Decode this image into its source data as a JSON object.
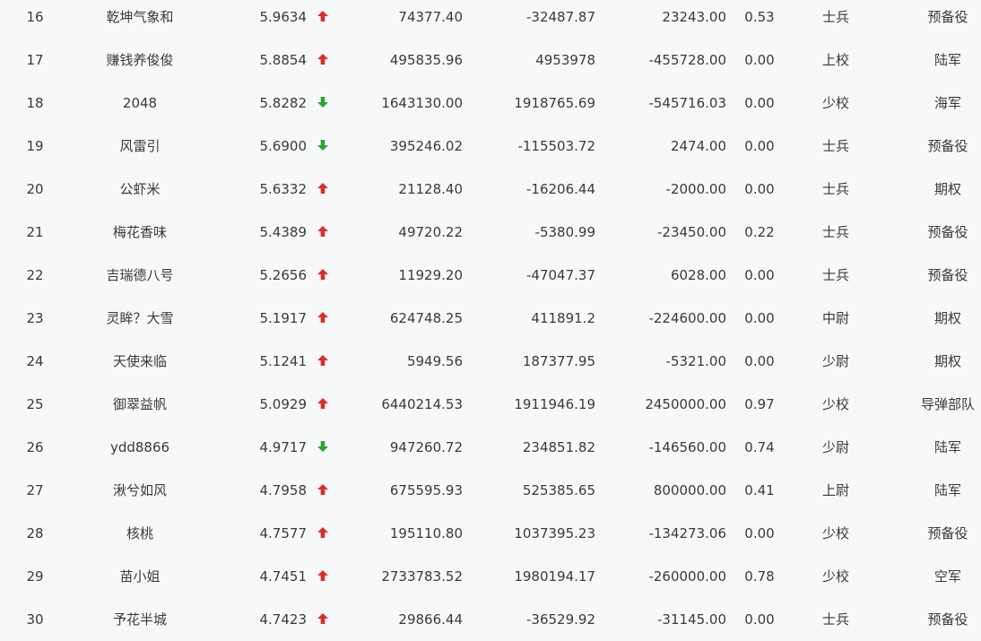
{
  "colors": {
    "up": "#e02a2a",
    "down": "#2aa52a"
  },
  "icons": {
    "up": "red-up-arrow-icon",
    "down": "green-down-arrow-icon"
  },
  "rows": [
    {
      "rank": "16",
      "name": "乾坤气象和",
      "score": "5.9634",
      "trend": "up",
      "a": "74377.40",
      "b": "-32487.87",
      "c": "23243.00",
      "d": "0.53",
      "title": "士兵",
      "branch": "预备役"
    },
    {
      "rank": "17",
      "name": "赚钱养俊俊",
      "score": "5.8854",
      "trend": "up",
      "a": "495835.96",
      "b": "4953978",
      "c": "-455728.00",
      "d": "0.00",
      "title": "上校",
      "branch": "陆军"
    },
    {
      "rank": "18",
      "name": "2048",
      "score": "5.8282",
      "trend": "down",
      "a": "1643130.00",
      "b": "1918765.69",
      "c": "-545716.03",
      "d": "0.00",
      "title": "少校",
      "branch": "海军"
    },
    {
      "rank": "19",
      "name": "风雷引",
      "score": "5.6900",
      "trend": "down",
      "a": "395246.02",
      "b": "-115503.72",
      "c": "2474.00",
      "d": "0.00",
      "title": "士兵",
      "branch": "预备役"
    },
    {
      "rank": "20",
      "name": "公虾米",
      "score": "5.6332",
      "trend": "up",
      "a": "21128.40",
      "b": "-16206.44",
      "c": "-2000.00",
      "d": "0.00",
      "title": "士兵",
      "branch": "期权"
    },
    {
      "rank": "21",
      "name": "梅花香味",
      "score": "5.4389",
      "trend": "up",
      "a": "49720.22",
      "b": "-5380.99",
      "c": "-23450.00",
      "d": "0.22",
      "title": "士兵",
      "branch": "预备役"
    },
    {
      "rank": "22",
      "name": "吉瑞德八号",
      "score": "5.2656",
      "trend": "up",
      "a": "11929.20",
      "b": "-47047.37",
      "c": "6028.00",
      "d": "0.00",
      "title": "士兵",
      "branch": "预备役"
    },
    {
      "rank": "23",
      "name": "灵眸？大雪",
      "score": "5.1917",
      "trend": "up",
      "a": "624748.25",
      "b": "411891.2",
      "c": "-224600.00",
      "d": "0.00",
      "title": "中尉",
      "branch": "期权"
    },
    {
      "rank": "24",
      "name": "天使来临",
      "score": "5.1241",
      "trend": "up",
      "a": "5949.56",
      "b": "187377.95",
      "c": "-5321.00",
      "d": "0.00",
      "title": "少尉",
      "branch": "期权"
    },
    {
      "rank": "25",
      "name": "御翠益帆",
      "score": "5.0929",
      "trend": "up",
      "a": "6440214.53",
      "b": "1911946.19",
      "c": "2450000.00",
      "d": "0.97",
      "title": "少校",
      "branch": "导弹部队"
    },
    {
      "rank": "26",
      "name": "ydd8866",
      "score": "4.9717",
      "trend": "down",
      "a": "947260.72",
      "b": "234851.82",
      "c": "-146560.00",
      "d": "0.74",
      "title": "少尉",
      "branch": "陆军"
    },
    {
      "rank": "27",
      "name": "湫兮如风",
      "score": "4.7958",
      "trend": "up",
      "a": "675595.93",
      "b": "525385.65",
      "c": "800000.00",
      "d": "0.41",
      "title": "上尉",
      "branch": "陆军"
    },
    {
      "rank": "28",
      "name": "核桃",
      "score": "4.7577",
      "trend": "up",
      "a": "195110.80",
      "b": "1037395.23",
      "c": "-134273.06",
      "d": "0.00",
      "title": "少校",
      "branch": "预备役"
    },
    {
      "rank": "29",
      "name": "苗小姐",
      "score": "4.7451",
      "trend": "up",
      "a": "2733783.52",
      "b": "1980194.17",
      "c": "-260000.00",
      "d": "0.78",
      "title": "少校",
      "branch": "空军"
    },
    {
      "rank": "30",
      "name": "予花半城",
      "score": "4.7423",
      "trend": "up",
      "a": "29866.44",
      "b": "-36529.92",
      "c": "-31145.00",
      "d": "0.00",
      "title": "士兵",
      "branch": "预备役"
    }
  ]
}
